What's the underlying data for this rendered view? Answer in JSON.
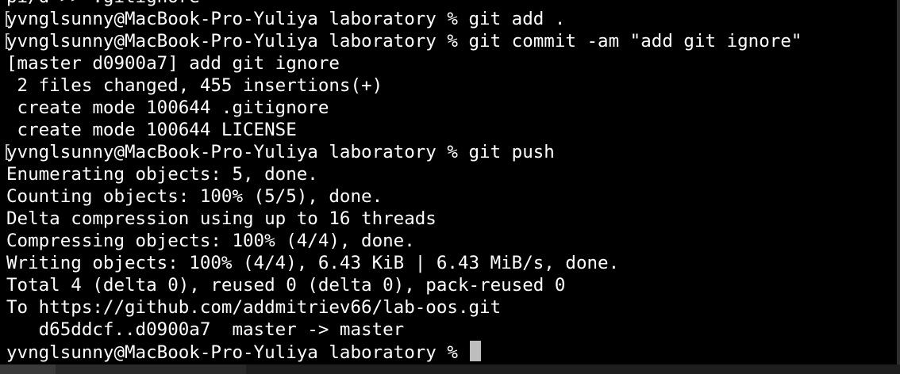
{
  "terminal": {
    "lines": [
      {
        "text": "pi/d >> .gitignore",
        "prompt": false
      },
      {
        "text": "yvnglsunny@MacBook-Pro-Yuliya laboratory % git add .",
        "prompt": true
      },
      {
        "text": "yvnglsunny@MacBook-Pro-Yuliya laboratory % git commit -am \"add git ignore\"",
        "prompt": true
      },
      {
        "text": "[master d0900a7] add git ignore",
        "prompt": false
      },
      {
        "text": " 2 files changed, 455 insertions(+)",
        "prompt": false
      },
      {
        "text": " create mode 100644 .gitignore",
        "prompt": false
      },
      {
        "text": " create mode 100644 LICENSE",
        "prompt": false
      },
      {
        "text": "yvnglsunny@MacBook-Pro-Yuliya laboratory % git push",
        "prompt": true
      },
      {
        "text": "Enumerating objects: 5, done.",
        "prompt": false
      },
      {
        "text": "Counting objects: 100% (5/5), done.",
        "prompt": false
      },
      {
        "text": "Delta compression using up to 16 threads",
        "prompt": false
      },
      {
        "text": "Compressing objects: 100% (4/4), done.",
        "prompt": false
      },
      {
        "text": "Writing objects: 100% (4/4), 6.43 KiB | 6.43 MiB/s, done.",
        "prompt": false
      },
      {
        "text": "Total 4 (delta 0), reused 0 (delta 0), pack-reused 0",
        "prompt": false
      },
      {
        "text": "To https://github.com/addmitriev66/lab-oos.git",
        "prompt": false
      },
      {
        "text": "   d65ddcf..d0900a7  master -> master",
        "prompt": false
      },
      {
        "text": "yvnglsunny@MacBook-Pro-Yuliya laboratory % ",
        "prompt": false,
        "cursor": true
      }
    ],
    "colors": {
      "background": "#000000",
      "text": "#ffffff",
      "cursor": "#bdbdbd",
      "frame": "#2b2b2b"
    }
  }
}
